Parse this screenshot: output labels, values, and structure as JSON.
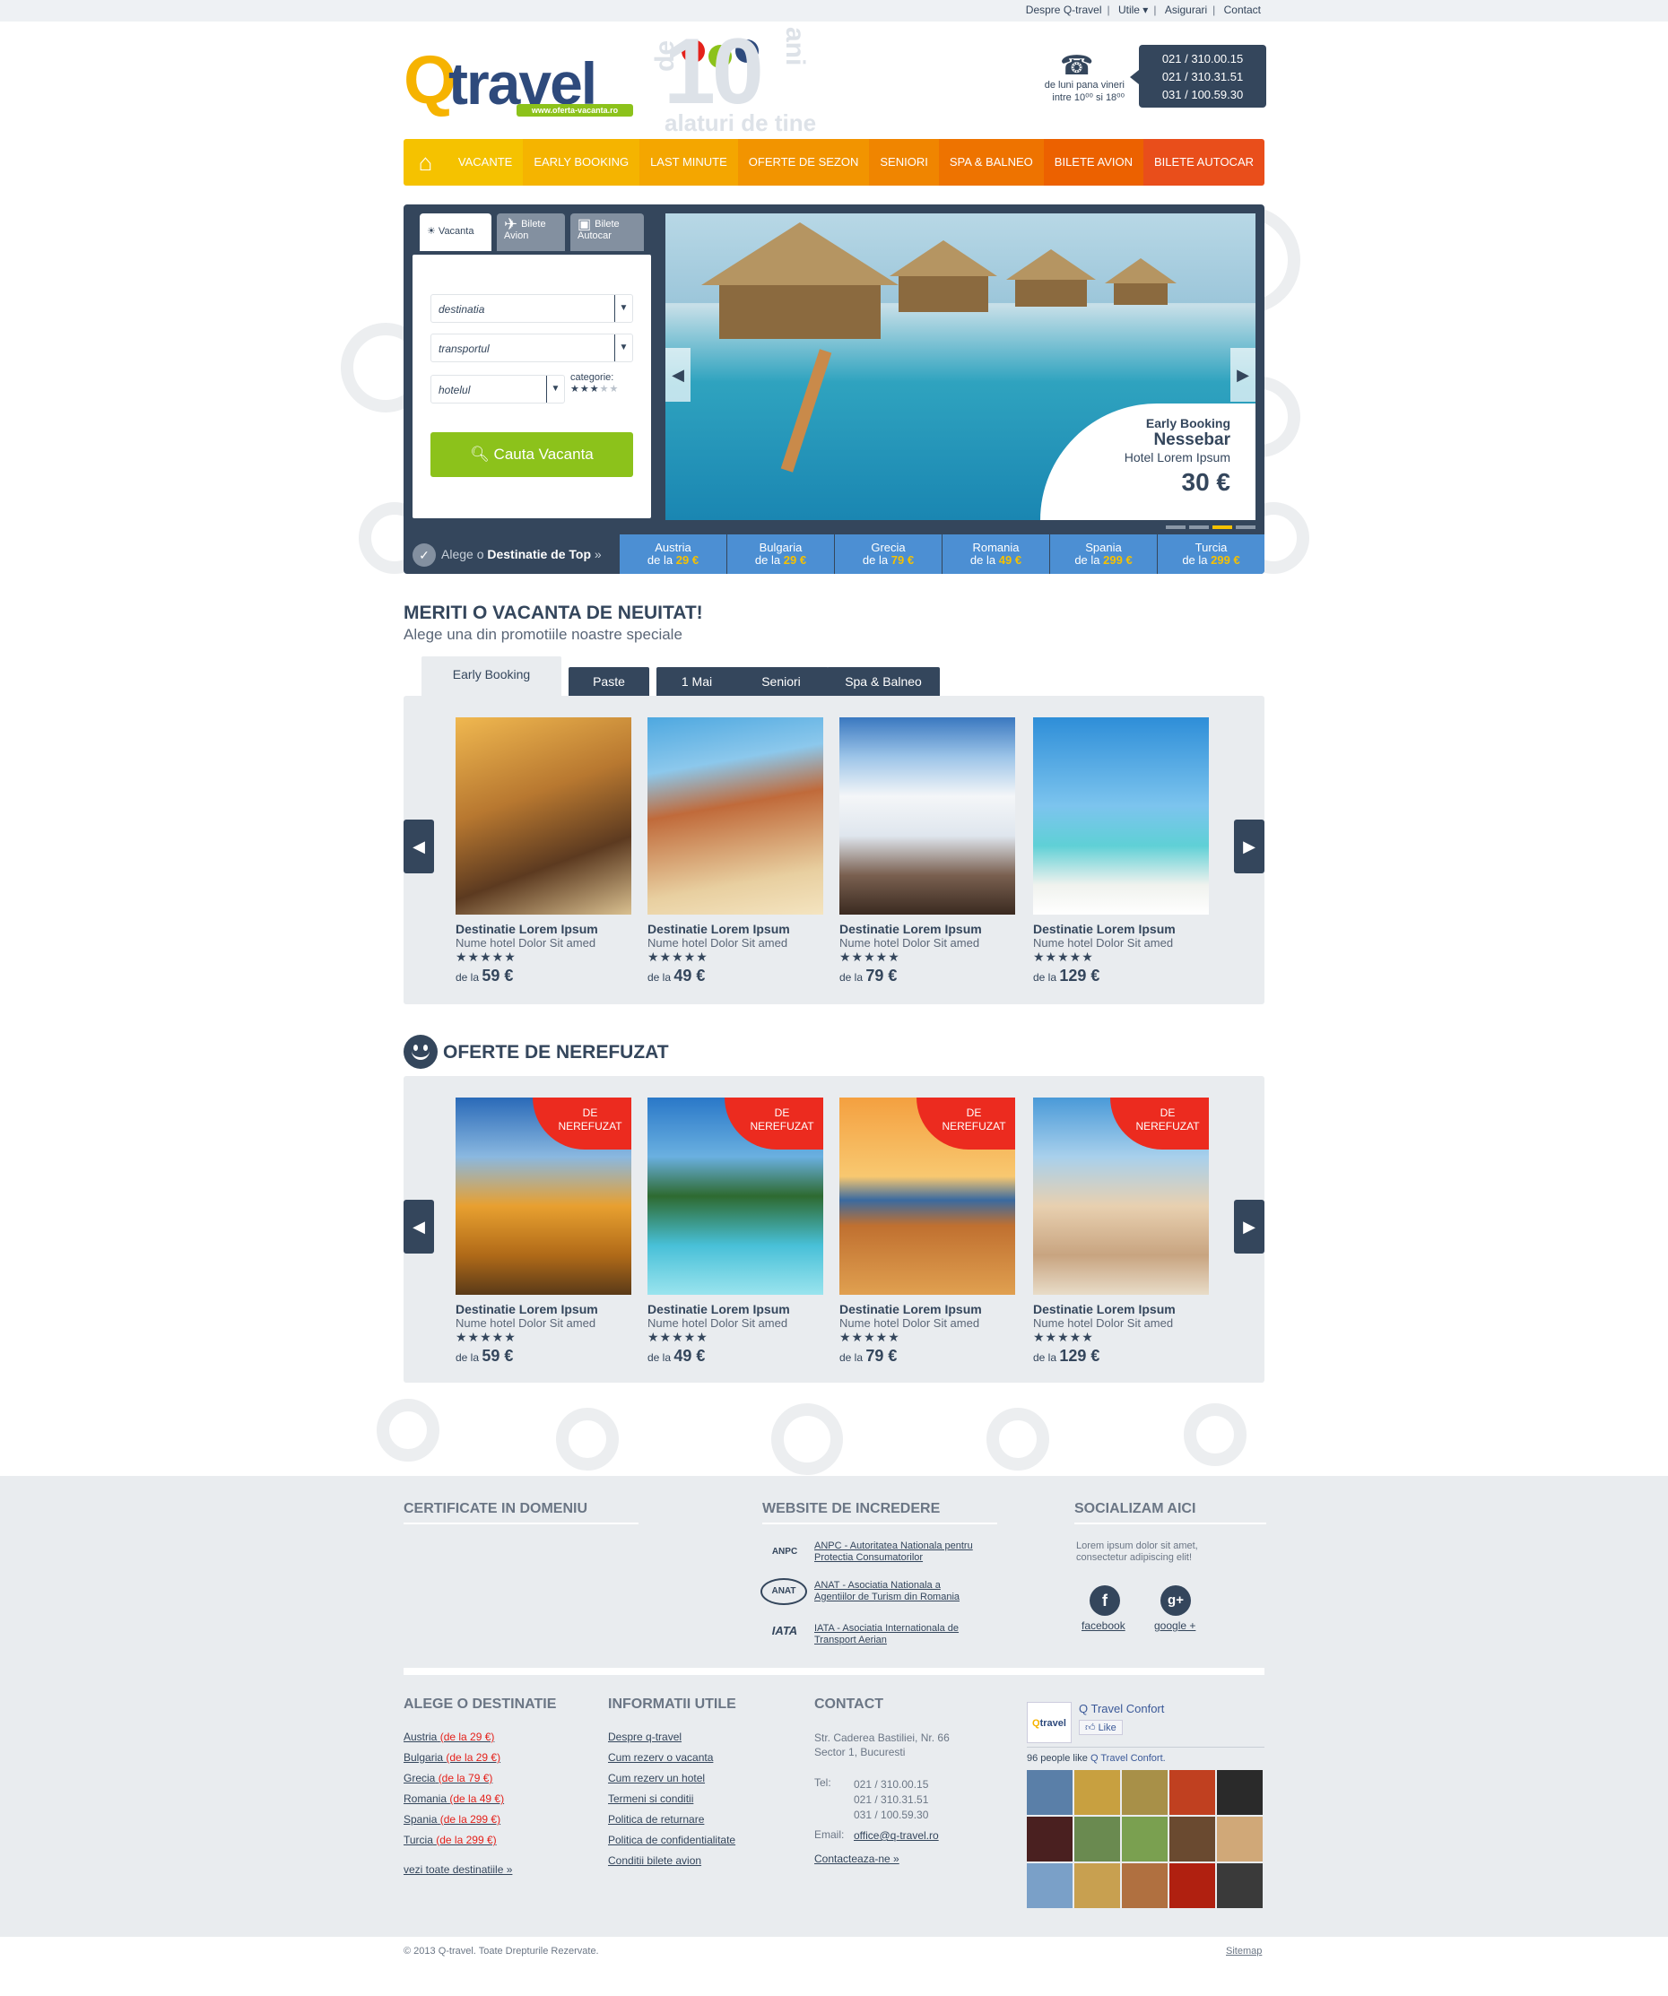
{
  "topnav": [
    "Despre Q-travel",
    "Utile ▾",
    "Asigurari",
    "Contact"
  ],
  "logo": {
    "q": "Q",
    "travel": "travel",
    "url": "www.oferta-vacanta.ro"
  },
  "anniversary": {
    "de": "de",
    "num": "10",
    "ani": "ani",
    "tagline": "alaturi de tine"
  },
  "phone": {
    "schedule_l1": "de luni pana vineri",
    "schedule_l2": "intre 10⁰⁰ si 18⁰⁰",
    "numbers": [
      "021 / 310.00.15",
      "021 / 310.31.51",
      "031 / 100.59.30"
    ]
  },
  "nav": {
    "items": [
      {
        "label": "VACANTE",
        "color": "#f5c200"
      },
      {
        "label": "EARLY BOOKING",
        "color": "#f5b400"
      },
      {
        "label": "LAST MINUTE",
        "color": "#f4a600"
      },
      {
        "label": "OFERTE DE SEZON",
        "color": "#f29400"
      },
      {
        "label": "SENIORI",
        "color": "#f08500"
      },
      {
        "label": "SPA & BALNEO",
        "color": "#ee7300"
      },
      {
        "label": "BILETE AVION",
        "color": "#ec6100"
      },
      {
        "label": "BILETE AUTOCAR",
        "color": "#e94e1b"
      }
    ]
  },
  "search": {
    "tabs": [
      {
        "label": "Vacanta"
      },
      {
        "label": "Bilete Avion"
      },
      {
        "label": "Bilete Autocar"
      }
    ],
    "destination": "destinatia",
    "transport": "transportul",
    "hotel": "hotelul",
    "category_label": "categorie:",
    "button": "Cauta Vacanta"
  },
  "hero": {
    "line1": "Early Booking",
    "line2": "Nessebar",
    "line3": "Hotel Lorem Ipsum",
    "price": "30 €"
  },
  "top_destinations": {
    "label_prefix": "Alege o",
    "label_bold": "Destinatie de Top",
    "label_suffix": "»",
    "items": [
      {
        "name": "Austria",
        "from": "de la",
        "price": "29 €"
      },
      {
        "name": "Bulgaria",
        "from": "de la",
        "price": "29 €"
      },
      {
        "name": "Grecia",
        "from": "de la",
        "price": "79 €"
      },
      {
        "name": "Romania",
        "from": "de la",
        "price": "49 €"
      },
      {
        "name": "Spania",
        "from": "de la",
        "price": "299 €"
      },
      {
        "name": "Turcia",
        "from": "de la",
        "price": "299 €"
      }
    ]
  },
  "promo": {
    "title": "MERITI O VACANTA DE NEUITAT!",
    "subtitle": "Alege una din promotiile noastre speciale",
    "tabs": [
      "Early Booking",
      "Paste",
      "1 Mai",
      "Seniori",
      "Spa & Balneo"
    ],
    "cards": [
      {
        "title": "Destinatie Lorem Ipsum",
        "hotel": "Nume hotel Dolor Sit amed",
        "from": "de la",
        "price": "59 €"
      },
      {
        "title": "Destinatie Lorem Ipsum",
        "hotel": "Nume hotel Dolor Sit amed",
        "from": "de la",
        "price": "49 €"
      },
      {
        "title": "Destinatie Lorem Ipsum",
        "hotel": "Nume hotel Dolor Sit amed",
        "from": "de la",
        "price": "79 €"
      },
      {
        "title": "Destinatie Lorem Ipsum",
        "hotel": "Nume hotel Dolor Sit amed",
        "from": "de la",
        "price": "129 €"
      }
    ]
  },
  "offers": {
    "title": "OFERTE DE NEREFUZAT",
    "ribbon_l1": "DE",
    "ribbon_l2": "NEREFUZAT",
    "cards": [
      {
        "title": "Destinatie Lorem Ipsum",
        "hotel": "Nume hotel Dolor Sit amed",
        "from": "de la",
        "price": "59 €"
      },
      {
        "title": "Destinatie Lorem Ipsum",
        "hotel": "Nume hotel Dolor Sit amed",
        "from": "de la",
        "price": "49 €"
      },
      {
        "title": "Destinatie Lorem Ipsum",
        "hotel": "Nume hotel Dolor Sit amed",
        "from": "de la",
        "price": "79 €"
      },
      {
        "title": "Destinatie Lorem Ipsum",
        "hotel": "Nume hotel Dolor Sit amed",
        "from": "de la",
        "price": "129 €"
      }
    ]
  },
  "footer": {
    "certificates_title": "CERTIFICATE IN DOMENIU",
    "trust_title": "WEBSITE DE INCREDERE",
    "trust": [
      {
        "logo": "ANPC",
        "l1": "ANPC - Autoritatea Nationala pentru",
        "l2": "Protectia Consumatorilor"
      },
      {
        "logo": "ANAT",
        "l1": "ANAT - Asociatia Nationala a",
        "l2": "Agentiilor de Turism din Romania"
      },
      {
        "logo": "IATA",
        "l1": "IATA - Asociatia Internationala de",
        "l2": "Transport Aerian"
      }
    ],
    "social_title": "SOCIALIZAM AICI",
    "social_text_l1": "Lorem ipsum dolor sit amet,",
    "social_text_l2": "consectetur adipiscing elit!",
    "facebook": "facebook",
    "google": "google +",
    "dest_title": "ALEGE O DESTINATIE",
    "destinations": [
      {
        "name": "Austria",
        "price": "(de la 29 €)"
      },
      {
        "name": "Bulgaria",
        "price": "(de la 29 €)"
      },
      {
        "name": "Grecia",
        "price": "(de la 79 €)"
      },
      {
        "name": "Romania",
        "price": "(de la 49 €)"
      },
      {
        "name": "Spania",
        "price": "(de la 299 €)"
      },
      {
        "name": "Turcia",
        "price": "(de la 299 €)"
      }
    ],
    "all_destinations": "vezi toate destinatiile »",
    "info_title": "INFORMATII UTILE",
    "info": [
      "Despre q-travel",
      "Cum rezerv o vacanta",
      "Cum rezerv un hotel",
      "Termeni si conditii",
      "Politica de returnare",
      "Politica de confidentialitate",
      "Conditii bilete avion"
    ],
    "contact_title": "CONTACT",
    "address_l1": "Str. Caderea Bastiliei, Nr. 66",
    "address_l2": "Sector 1, Bucuresti",
    "tel_label": "Tel:",
    "tel": [
      "021 / 310.00.15",
      "021 / 310.31.51",
      "031 / 100.59.30"
    ],
    "email_label": "Email:",
    "email": "office@q-travel.ro",
    "contact_link": "Contacteaza-ne »",
    "fb_page": "Q Travel Confort",
    "fb_like": "Like",
    "fb_count": "96 people like",
    "fb_count_page": "Q Travel Confort."
  },
  "copyright": "© 2013 Q-travel. Toate Drepturile Rezervate.",
  "sitemap": "Sitemap"
}
